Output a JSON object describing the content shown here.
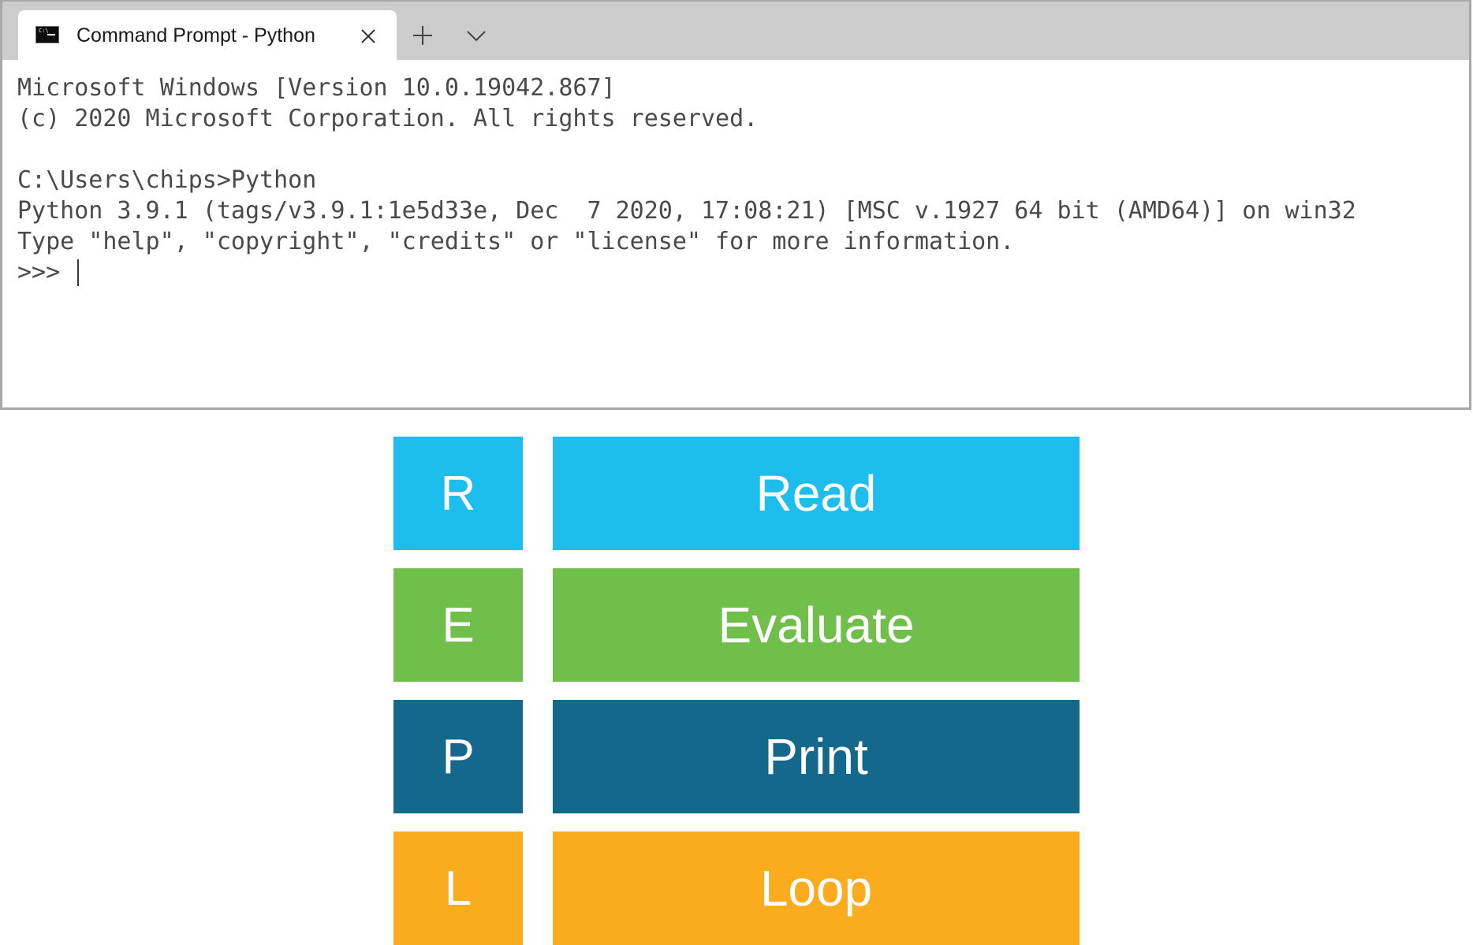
{
  "window": {
    "tab_title": "Command Prompt - Python",
    "tab_icon_glyph": "C:\\",
    "icons": {
      "tab": "terminal-icon",
      "close": "close-icon",
      "new_tab": "plus-icon",
      "dropdown": "chevron-down-icon"
    }
  },
  "terminal": {
    "lines": [
      "Microsoft Windows [Version 10.0.19042.867]",
      "(c) 2020 Microsoft Corporation. All rights reserved.",
      "",
      "C:\\Users\\chips>Python",
      "Python 3.9.1 (tags/v3.9.1:1e5d33e, Dec  7 2020, 17:08:21) [MSC v.1927 64 bit (AMD64)] on win32",
      "Type \"help\", \"copyright\", \"credits\" or \"license\" for more information."
    ],
    "prompt": ">>> ",
    "text_color": "#4a4a4a"
  },
  "repl": {
    "rows": [
      {
        "letter": "R",
        "word": "Read",
        "color": "#1dbeee"
      },
      {
        "letter": "E",
        "word": "Evaluate",
        "color": "#70bf4b"
      },
      {
        "letter": "P",
        "word": "Print",
        "color": "#14688b"
      },
      {
        "letter": "L",
        "word": "Loop",
        "color": "#fbab1e"
      }
    ]
  }
}
